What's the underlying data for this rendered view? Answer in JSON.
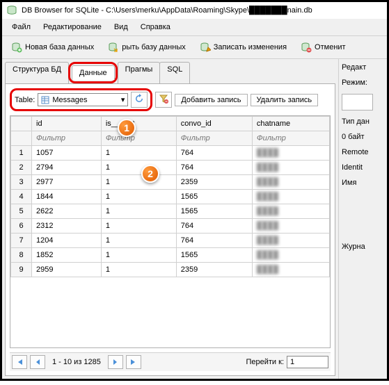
{
  "title": "DB Browser for SQLite - C:\\Users\\merku\\AppData\\Roaming\\Skype\\███████nain.db",
  "menu": {
    "file": "Файл",
    "edit": "Редактирование",
    "view": "Вид",
    "help": "Справка"
  },
  "toolbar": {
    "new_db": "Новая база данных",
    "open_db": "рыть базу данных",
    "write_changes": "Записать изменения",
    "revert": "Отменит"
  },
  "tabs": {
    "structure": "Структура БД",
    "data": "Данные",
    "pragmas": "Прагмы",
    "sql": "SQL"
  },
  "table_ctrl": {
    "label": "Table:",
    "selected": "Messages",
    "add_record": "Добавить запись",
    "delete_record": "Удалить запись"
  },
  "columns": [
    "id",
    "is___ent",
    "convo_id",
    "chatname"
  ],
  "filter_placeholder": "Фильтр",
  "rows": [
    {
      "n": 1,
      "id": "1057",
      "is": "1",
      "convo": "764",
      "chat": "████"
    },
    {
      "n": 2,
      "id": "2794",
      "is": "1",
      "convo": "764",
      "chat": "████"
    },
    {
      "n": 3,
      "id": "2977",
      "is": "1",
      "convo": "2359",
      "chat": "████"
    },
    {
      "n": 4,
      "id": "1844",
      "is": "1",
      "convo": "1565",
      "chat": "████"
    },
    {
      "n": 5,
      "id": "2622",
      "is": "1",
      "convo": "1565",
      "chat": "████"
    },
    {
      "n": 6,
      "id": "2312",
      "is": "1",
      "convo": "764",
      "chat": "████"
    },
    {
      "n": 7,
      "id": "1204",
      "is": "1",
      "convo": "764",
      "chat": "████"
    },
    {
      "n": 8,
      "id": "1852",
      "is": "1",
      "convo": "1565",
      "chat": "████"
    },
    {
      "n": 9,
      "id": "2959",
      "is": "1",
      "convo": "2359",
      "chat": "████"
    }
  ],
  "nav": {
    "range": "1 - 10 из 1285",
    "goto_label": "Перейти к:",
    "goto_value": "1"
  },
  "right": {
    "edit": "Редакт",
    "mode": "Режим:",
    "type": "Тип дан",
    "size": "0 байт",
    "remote": "Remote",
    "identity": "Identit",
    "name": "Имя",
    "journal": "Журна"
  },
  "callouts": {
    "c1": "1",
    "c2": "2"
  }
}
